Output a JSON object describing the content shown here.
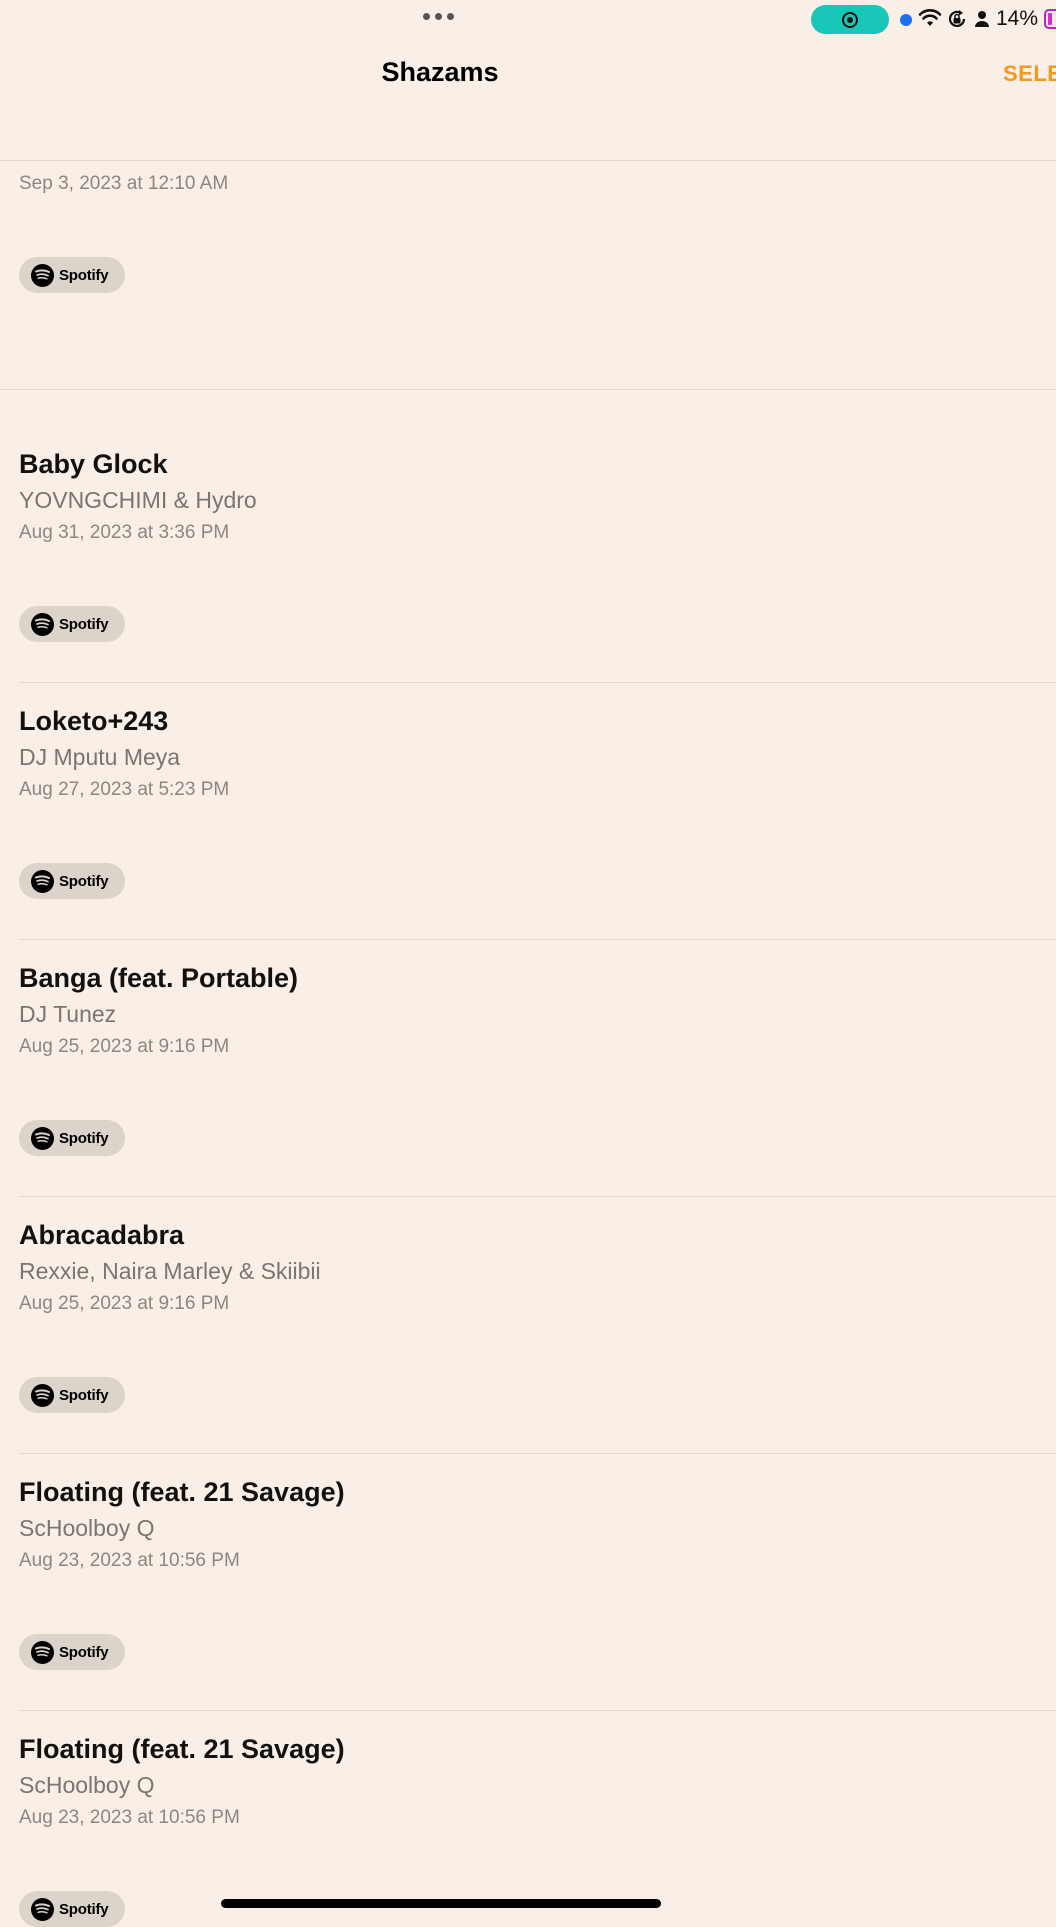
{
  "status_bar": {
    "battery": "14%",
    "accent_record": "#18c7b8",
    "dot_color": "#1e6ef0"
  },
  "nav": {
    "title": "Shazams",
    "select_label": "SELE"
  },
  "colors": {
    "background": "#f9efe6",
    "accent": "#f39a1e",
    "secondary_text": "#7b756f"
  },
  "top_partial": {
    "date": "Sep 3, 2023 at 12:10 AM",
    "spotify_label": "Spotify"
  },
  "shazams": [
    {
      "title": "Baby Glock",
      "artist": "YOVNGCHIMI & Hydro",
      "date": "Aug 31, 2023 at 3:36 PM",
      "spotify_label": "Spotify"
    },
    {
      "title": "Loketo+243",
      "artist": "DJ Mputu Meya",
      "date": "Aug 27, 2023 at 5:23 PM",
      "spotify_label": "Spotify"
    },
    {
      "title": "Banga (feat. Portable)",
      "artist": "DJ Tunez",
      "date": "Aug 25, 2023 at 9:16 PM",
      "spotify_label": "Spotify"
    },
    {
      "title": "Abracadabra",
      "artist": "Rexxie, Naira Marley & Skiibii",
      "date": "Aug 25, 2023 at 9:16 PM",
      "spotify_label": "Spotify"
    },
    {
      "title": "Floating (feat. 21 Savage)",
      "artist": "ScHoolboy Q",
      "date": "Aug 23, 2023 at 10:56 PM",
      "spotify_label": "Spotify"
    },
    {
      "title": "Floating (feat. 21 Savage)",
      "artist": "ScHoolboy Q",
      "date": "Aug 23, 2023 at 10:56 PM",
      "spotify_label": "Spotify"
    }
  ]
}
